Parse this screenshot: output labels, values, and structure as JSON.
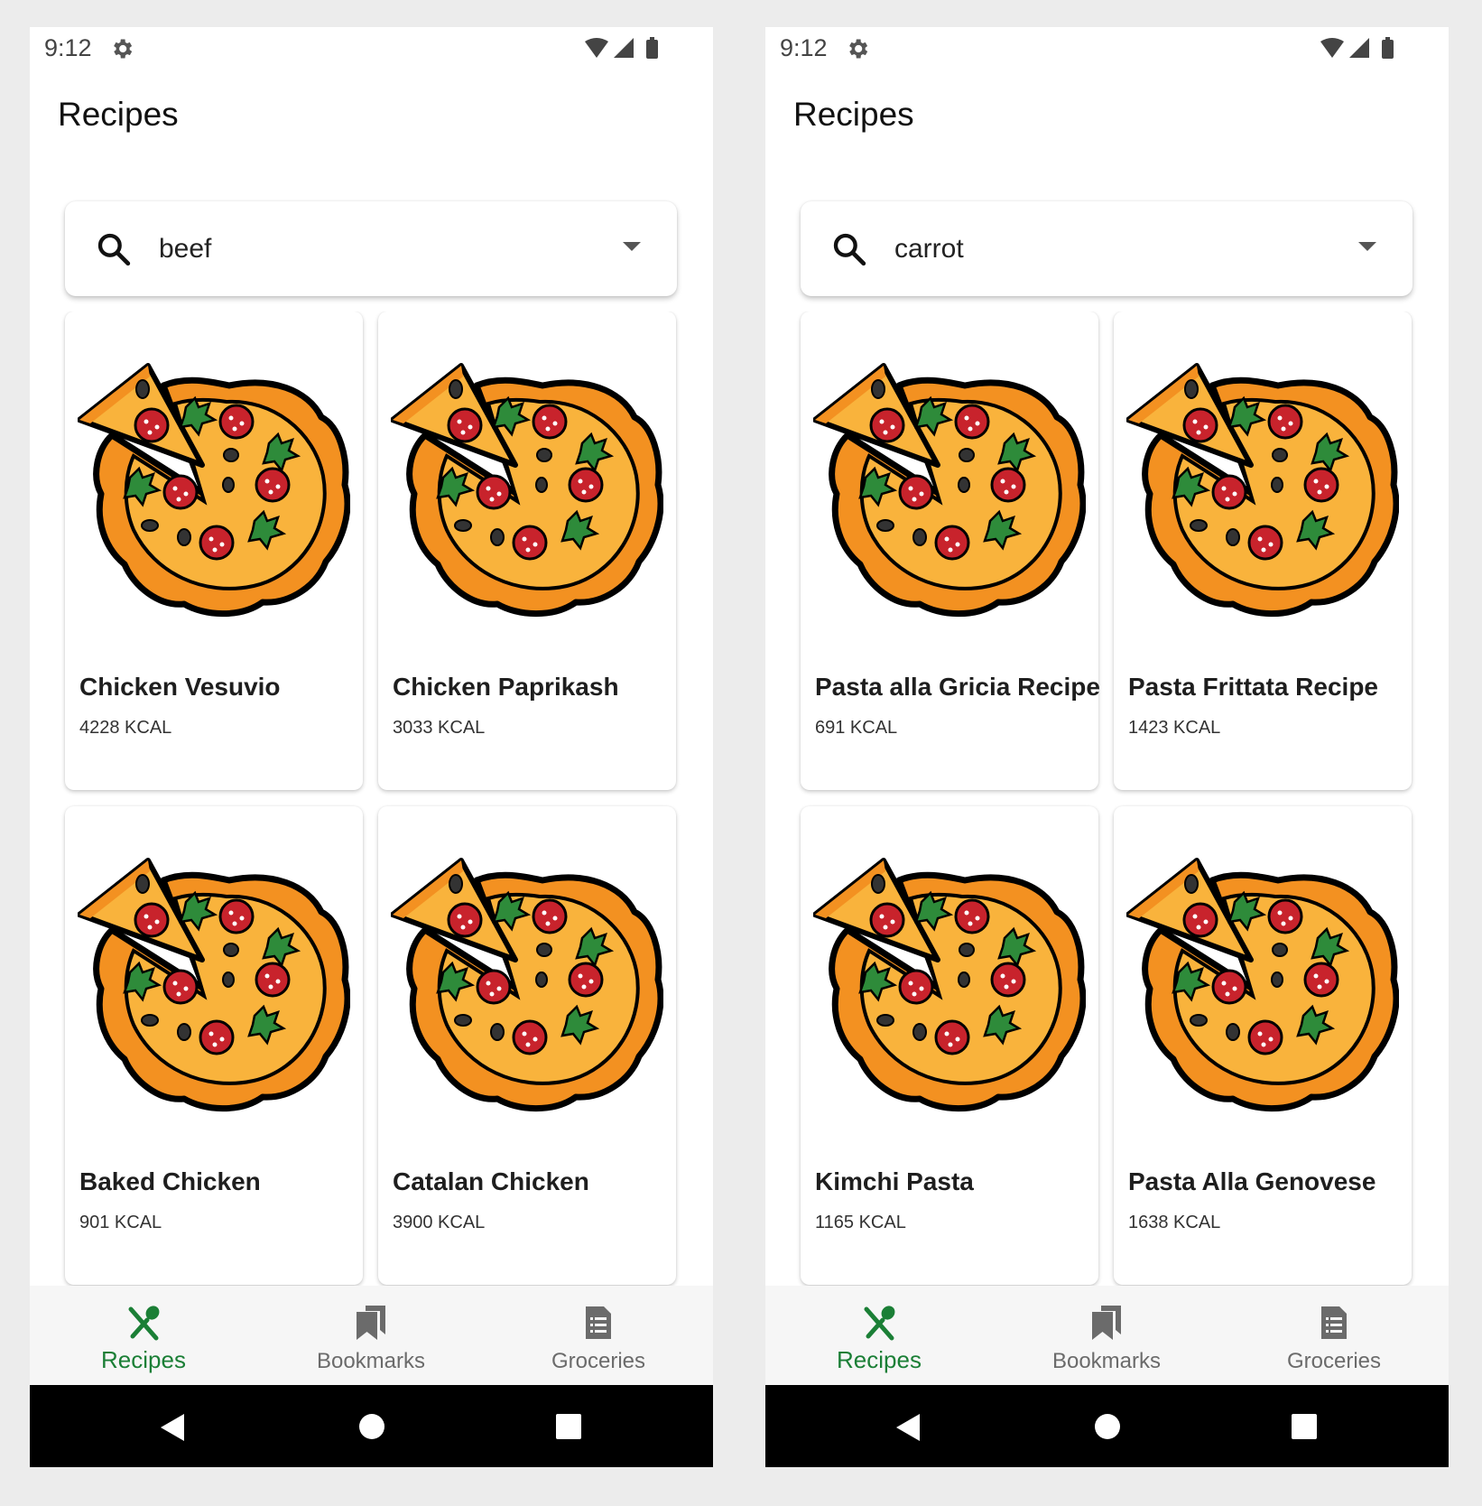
{
  "colors": {
    "accent": "#1b7f36",
    "inactive_nav": "#6b6b6b",
    "nav_background": "#f6f6f6",
    "system_bar": "#000000",
    "page_background": "#ececec"
  },
  "screens": [
    {
      "status_bar": {
        "time": "9:12",
        "icons": [
          "gear-icon",
          "wifi-icon",
          "signal-icon",
          "battery-icon"
        ]
      },
      "app_title": "Recipes",
      "search": {
        "query": "beef",
        "icon": "search-icon",
        "dropdown_icon": "dropdown-arrow-icon"
      },
      "recipes": [
        {
          "name": "Chicken Vesuvio",
          "kcal": "4228 KCAL",
          "image": "pizza-illustration"
        },
        {
          "name": "Chicken Paprikash",
          "kcal": "3033 KCAL",
          "image": "pizza-illustration"
        },
        {
          "name": "Baked Chicken",
          "kcal": "901 KCAL",
          "image": "pizza-illustration"
        },
        {
          "name": "Catalan Chicken",
          "kcal": "3900 KCAL",
          "image": "pizza-illustration"
        }
      ],
      "bottom_nav": [
        {
          "label": "Recipes",
          "icon": "fork-spoon-icon",
          "active": true
        },
        {
          "label": "Bookmarks",
          "icon": "bookmarks-icon",
          "active": false
        },
        {
          "label": "Groceries",
          "icon": "groceries-list-icon",
          "active": false
        }
      ],
      "system_nav": [
        "back-icon",
        "home-icon",
        "recents-icon"
      ]
    },
    {
      "status_bar": {
        "time": "9:12",
        "icons": [
          "gear-icon",
          "wifi-icon",
          "signal-icon",
          "battery-icon"
        ]
      },
      "app_title": "Recipes",
      "search": {
        "query": "carrot",
        "icon": "search-icon",
        "dropdown_icon": "dropdown-arrow-icon"
      },
      "recipes": [
        {
          "name": "Pasta alla Gricia Recipe",
          "kcal": "691 KCAL",
          "image": "pizza-illustration"
        },
        {
          "name": "Pasta Frittata Recipe",
          "kcal": "1423 KCAL",
          "image": "pizza-illustration"
        },
        {
          "name": "Kimchi Pasta",
          "kcal": "1165 KCAL",
          "image": "pizza-illustration"
        },
        {
          "name": "Pasta Alla Genovese",
          "kcal": "1638 KCAL",
          "image": "pizza-illustration"
        }
      ],
      "bottom_nav": [
        {
          "label": "Recipes",
          "icon": "fork-spoon-icon",
          "active": true
        },
        {
          "label": "Bookmarks",
          "icon": "bookmarks-icon",
          "active": false
        },
        {
          "label": "Groceries",
          "icon": "groceries-list-icon",
          "active": false
        }
      ],
      "system_nav": [
        "back-icon",
        "home-icon",
        "recents-icon"
      ]
    }
  ]
}
